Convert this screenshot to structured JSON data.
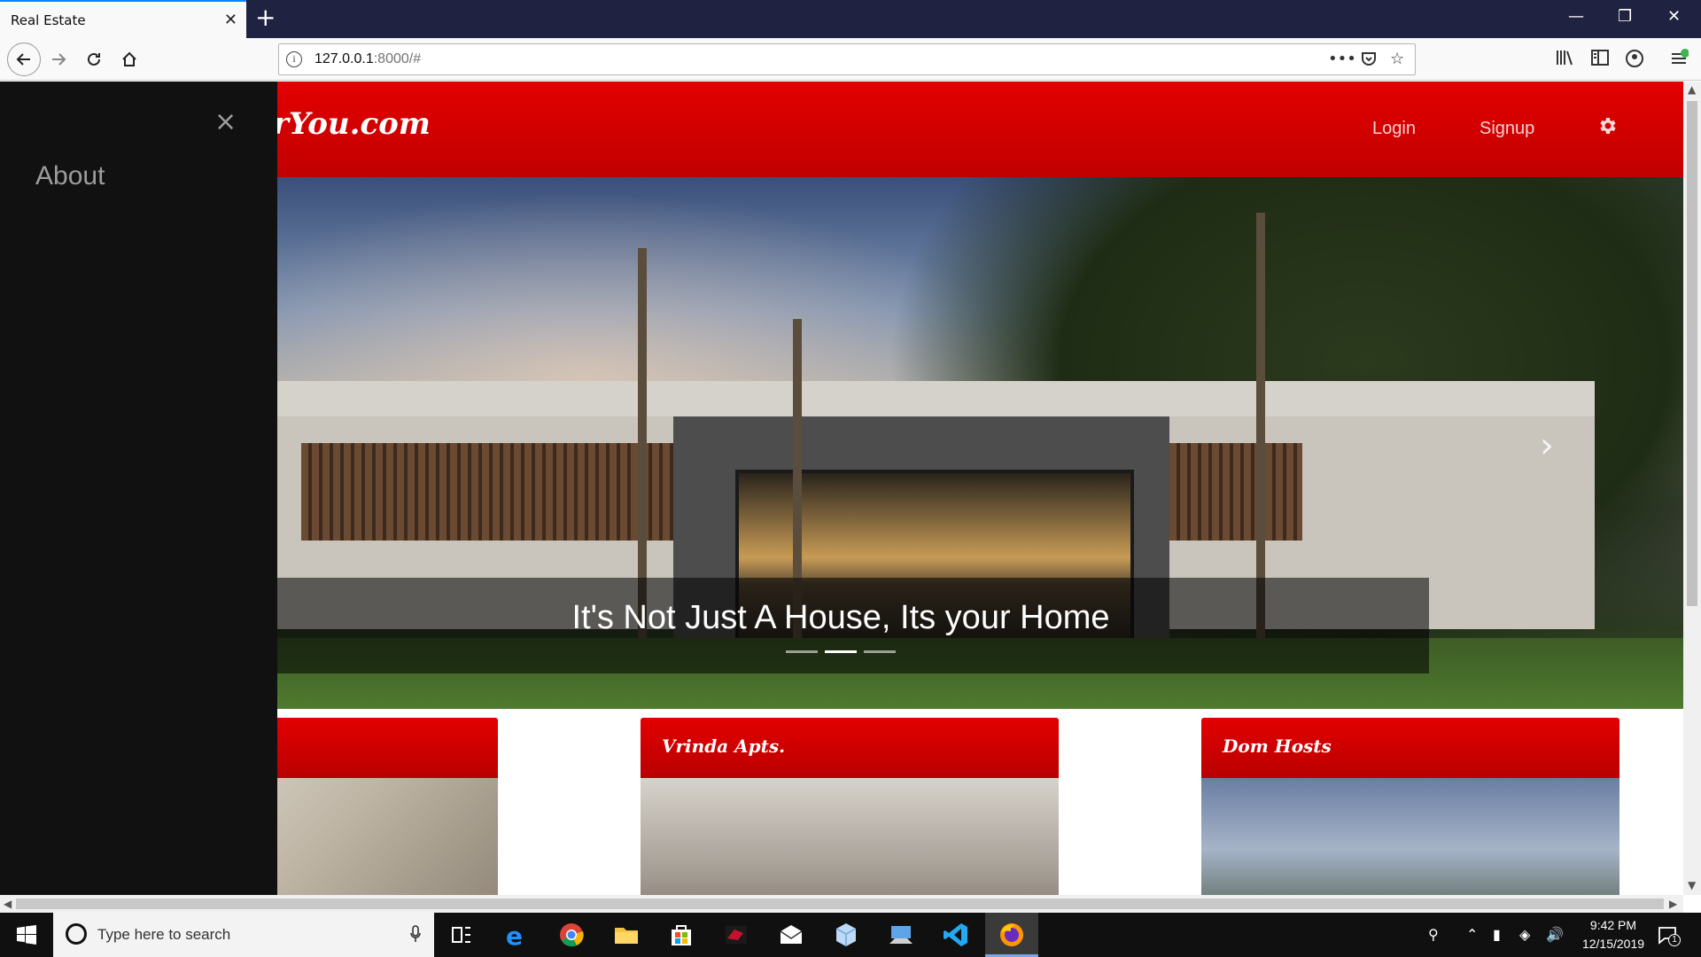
{
  "browser": {
    "tab_title": "Real Estate",
    "tab_close": "✕",
    "new_tab": "+",
    "url_host": "127.0.0.1",
    "url_rest": ":8000/#",
    "url_info_icon": "i"
  },
  "site": {
    "brand": "rYou.com",
    "nav": {
      "login": "Login",
      "signup": "Signup"
    },
    "hero_caption": "It's Not Just A House, Its your Home",
    "carousel_active_index": 1,
    "cards": [
      {
        "title": ""
      },
      {
        "title": "Vrinda Apts."
      },
      {
        "title": "Dom Hosts"
      }
    ]
  },
  "sidebar": {
    "close": "×",
    "links": [
      "About"
    ]
  },
  "taskbar": {
    "search_placeholder": "Type here to search",
    "time": "9:42 PM",
    "date": "12/15/2019",
    "notifications": "1"
  },
  "colors": {
    "brand_red": "#e30000",
    "sidebar_bg": "#111111",
    "tab_accent": "#0a84ff"
  }
}
